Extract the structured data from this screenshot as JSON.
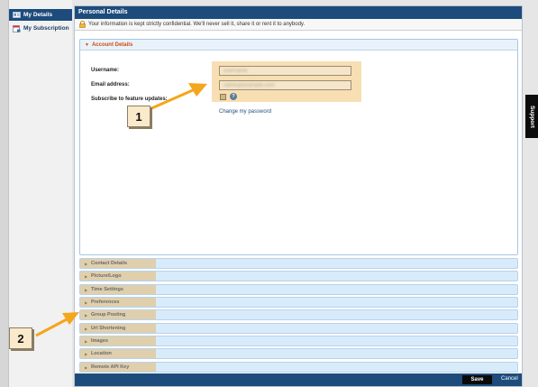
{
  "sidebar": {
    "items": [
      {
        "label": "My Details",
        "icon": "id-card-icon",
        "active": true
      },
      {
        "label": "My Subscription",
        "icon": "calendar-icon",
        "active": false
      }
    ]
  },
  "header": {
    "title": "Personal Details"
  },
  "notice": {
    "text": "Your information is kept strictly confidential. We'll never sell it, share it or rent it to anybody."
  },
  "account": {
    "title": "Account Details",
    "username_label": "Username:",
    "email_label": "Email address:",
    "subscribe_label": "Subscribe to feature updates:",
    "username_value": "username",
    "email_value": "name@example.com",
    "change_password": "Change my password"
  },
  "sections": [
    "Contact Details",
    "Picture/Logo",
    "Time Settings",
    "Preferences",
    "Group Posting",
    "Url Shortening",
    "Images",
    "Location",
    "Remote API Key"
  ],
  "footer": {
    "save": "Save",
    "cancel": "Cancel"
  },
  "support": {
    "label": "Support"
  },
  "callouts": {
    "one": "1",
    "two": "2"
  },
  "colors": {
    "brand": "#1d4c7c",
    "accent": "#d24a0f",
    "highlight": "#f7dfb3",
    "arrow": "#f4a61c"
  }
}
